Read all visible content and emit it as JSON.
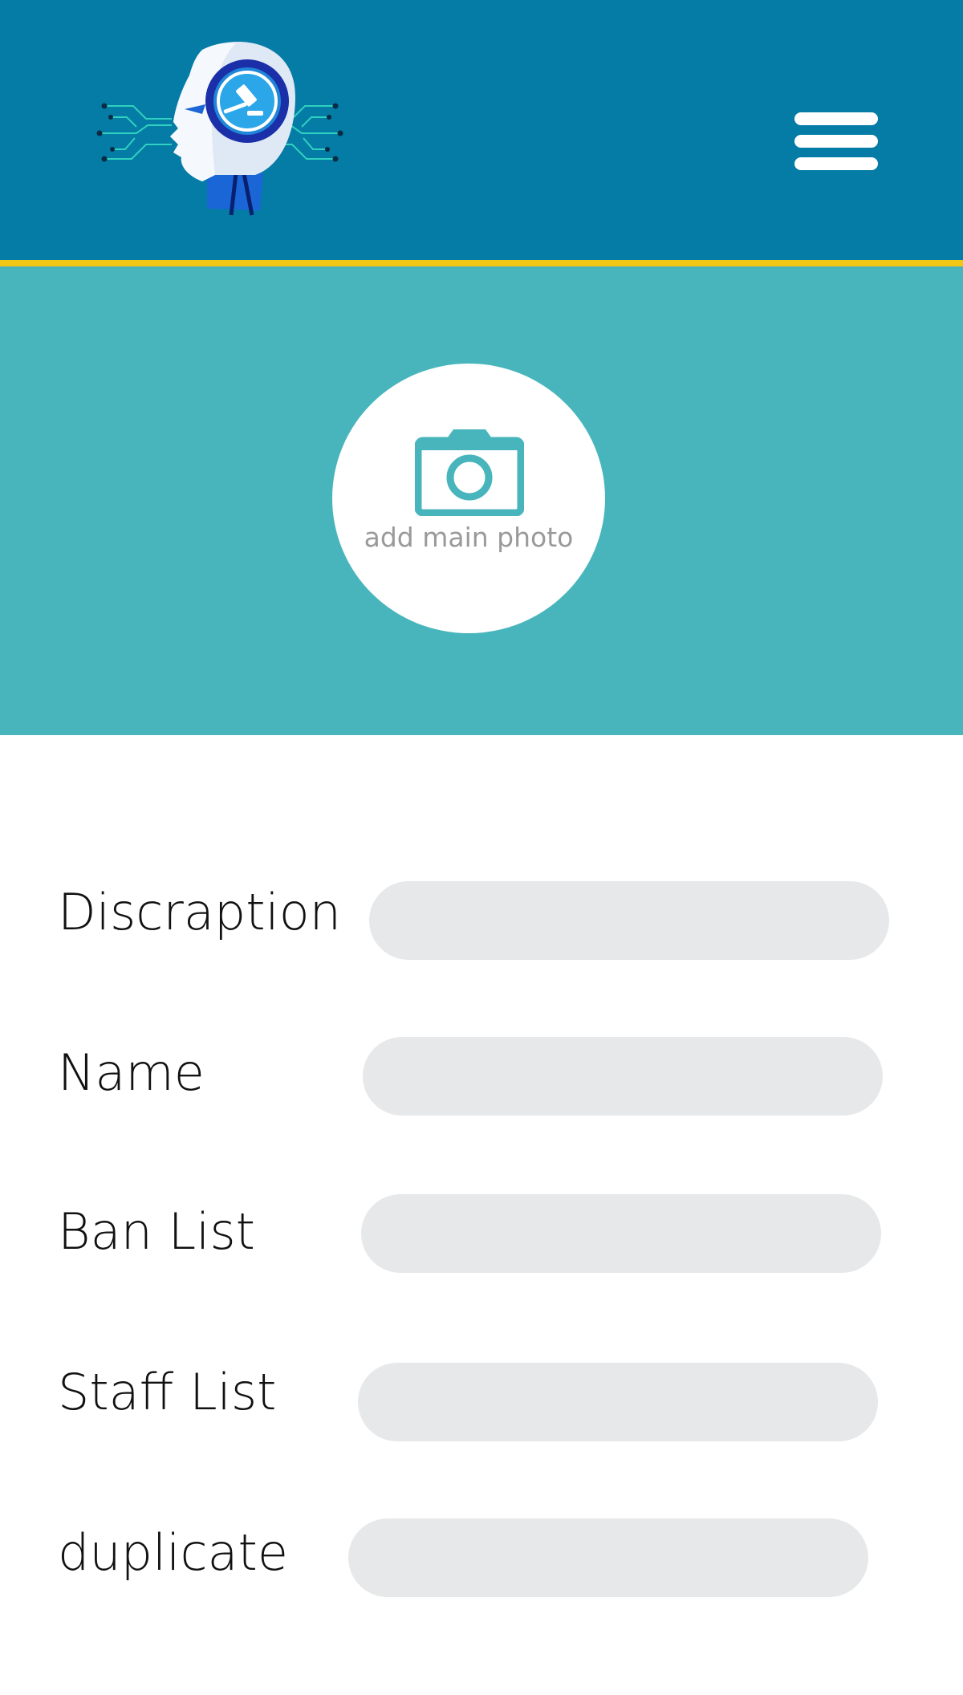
{
  "header": {
    "logo_icon": "robot-head-gavel-logo-icon",
    "menu_icon": "hamburger-menu-icon",
    "background": "#047ca5",
    "accent_line": "#f2c614"
  },
  "hero": {
    "background": "#48b5bd",
    "camera_icon": "camera-icon",
    "photo_label": "add main photo"
  },
  "form": {
    "fields": [
      {
        "label": "Discraption",
        "value": "",
        "placeholder": ""
      },
      {
        "label": "Name",
        "value": "",
        "placeholder": ""
      },
      {
        "label": "Ban List",
        "value": "",
        "placeholder": ""
      },
      {
        "label": "Staff List",
        "value": "",
        "placeholder": ""
      },
      {
        "label": "duplicate",
        "value": "",
        "placeholder": ""
      }
    ]
  }
}
